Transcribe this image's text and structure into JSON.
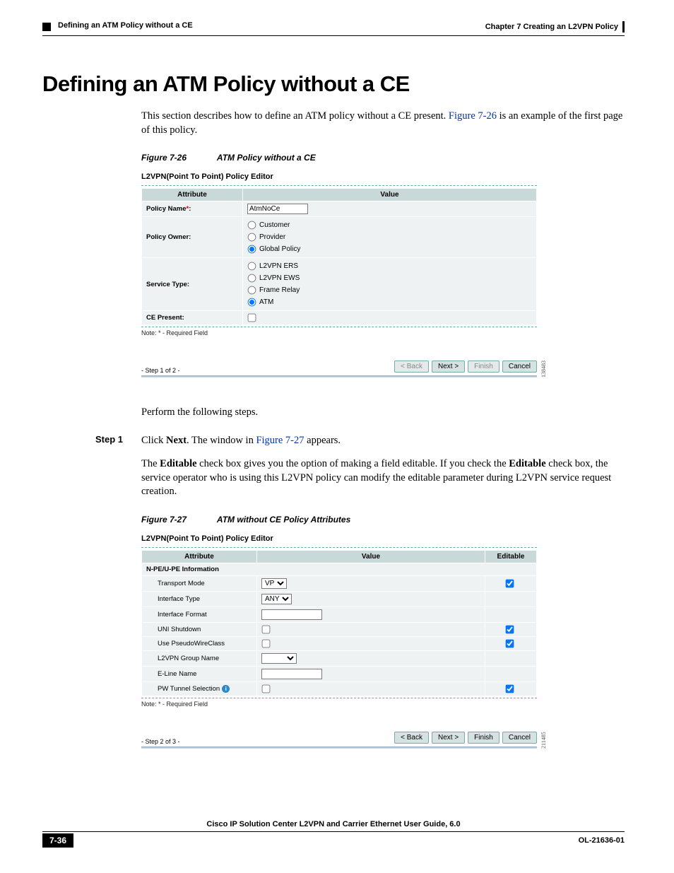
{
  "header": {
    "chapter": "Chapter 7      Creating an L2VPN Policy",
    "section": "Defining an ATM Policy without a CE"
  },
  "h1": "Defining an ATM Policy without a CE",
  "intro_before_link": "This section describes how to define an ATM policy without a CE present. ",
  "intro_link": "Figure 7-26",
  "intro_after_link": " is an example of the first page of this policy.",
  "fig26": {
    "label": "Figure 7-26",
    "title": "ATM Policy without a CE",
    "editor_title": "L2VPN(Point To Point) Policy Editor",
    "col_attribute": "Attribute",
    "col_value": "Value",
    "rows": {
      "policy_name_label": "Policy Name",
      "policy_name_value": "AtmNoCe",
      "policy_owner_label": "Policy Owner:",
      "owner_customer": "Customer",
      "owner_provider": "Provider",
      "owner_global": "Global Policy",
      "service_type_label": "Service Type:",
      "svc_l2vpn_ers": "L2VPN ERS",
      "svc_l2vpn_ews": "L2VPN EWS",
      "svc_frame_relay": "Frame Relay",
      "svc_atm": "ATM",
      "ce_present_label": "CE Present:"
    },
    "note": "Note: * - Required Field",
    "step": "- Step 1 of 2 -",
    "btn_back": "< Back",
    "btn_next": "Next >",
    "btn_finish": "Finish",
    "btn_cancel": "Cancel",
    "id": "138483"
  },
  "perform": "Perform the following steps.",
  "step1": {
    "label": "Step 1",
    "pre": "Click ",
    "bold1": "Next",
    "mid": ". The window in ",
    "link": "Figure 7-27",
    "post": " appears."
  },
  "editable_para_1": "The ",
  "editable_bold1": "Editable",
  "editable_para_2": " check box gives you the option of making a field editable. If you check the ",
  "editable_bold2": "Editable",
  "editable_para_3": " check box, the service operator who is using this L2VPN policy can modify the editable parameter during L2VPN service request creation.",
  "fig27": {
    "label": "Figure 7-27",
    "title": "ATM without CE Policy Attributes",
    "editor_title": "L2VPN(Point To Point) Policy Editor",
    "col_attribute": "Attribute",
    "col_value": "Value",
    "col_editable": "Editable",
    "section_header": "N-PE/U-PE Information",
    "rows": {
      "transport_mode_label": "Transport Mode",
      "transport_mode_value": "VP",
      "interface_type_label": "Interface Type",
      "interface_type_value": "ANY",
      "interface_format_label": "Interface Format",
      "uni_shutdown_label": "UNI Shutdown",
      "use_pw_class_label": "Use PseudoWireClass",
      "l2vpn_group_label": "L2VPN Group Name",
      "eline_name_label": "E-Line Name",
      "pw_tunnel_label": "PW Tunnel Selection"
    },
    "note": "Note: * - Required Field",
    "step": "- Step 2 of 3 -",
    "btn_back": "< Back",
    "btn_next": "Next >",
    "btn_finish": "Finish",
    "btn_cancel": "Cancel",
    "id": "211485"
  },
  "footer": {
    "book": "Cisco IP Solution Center L2VPN and Carrier Ethernet User Guide, 6.0",
    "pagenum": "7-36",
    "docnum": "OL-21636-01"
  }
}
